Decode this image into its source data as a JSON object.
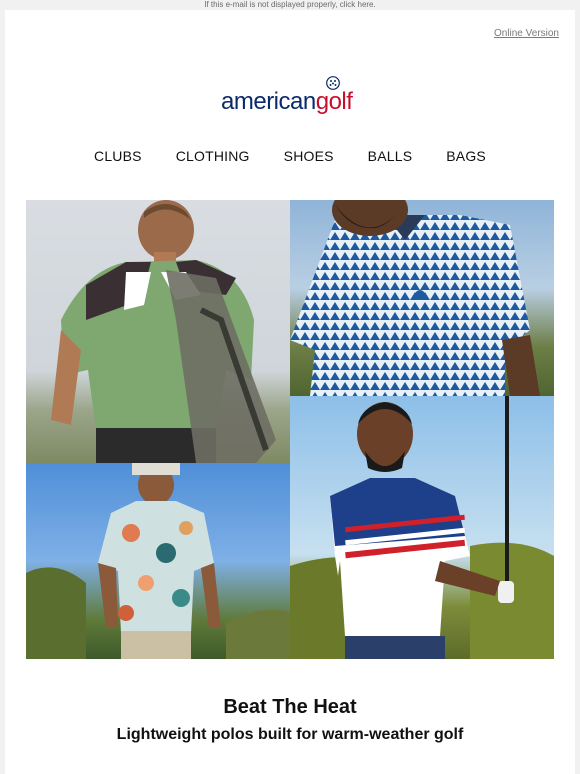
{
  "preheader": {
    "text": "If this e-mail is not displayed properly, click here."
  },
  "header": {
    "online_version": "Online Version",
    "logo": {
      "word_american": "american",
      "word_golf": "golf"
    }
  },
  "nav": {
    "items": [
      {
        "label": "CLUBS"
      },
      {
        "label": "CLOTHING"
      },
      {
        "label": "SHOES"
      },
      {
        "label": "BALLS"
      },
      {
        "label": "BAGS"
      }
    ]
  },
  "hero": {
    "images": [
      {
        "name": "green-polo-golfer-photo"
      },
      {
        "name": "blue-print-polo-photo"
      },
      {
        "name": "floral-polo-golfer-photo"
      },
      {
        "name": "striped-polo-golfer-photo"
      }
    ]
  },
  "content": {
    "title": "Beat The Heat",
    "subtitle": "Lightweight polos built for warm-weather golf"
  },
  "colors": {
    "brand_navy": "#0b2a6b",
    "brand_red": "#c8102e",
    "background": "#f1f1f1"
  }
}
